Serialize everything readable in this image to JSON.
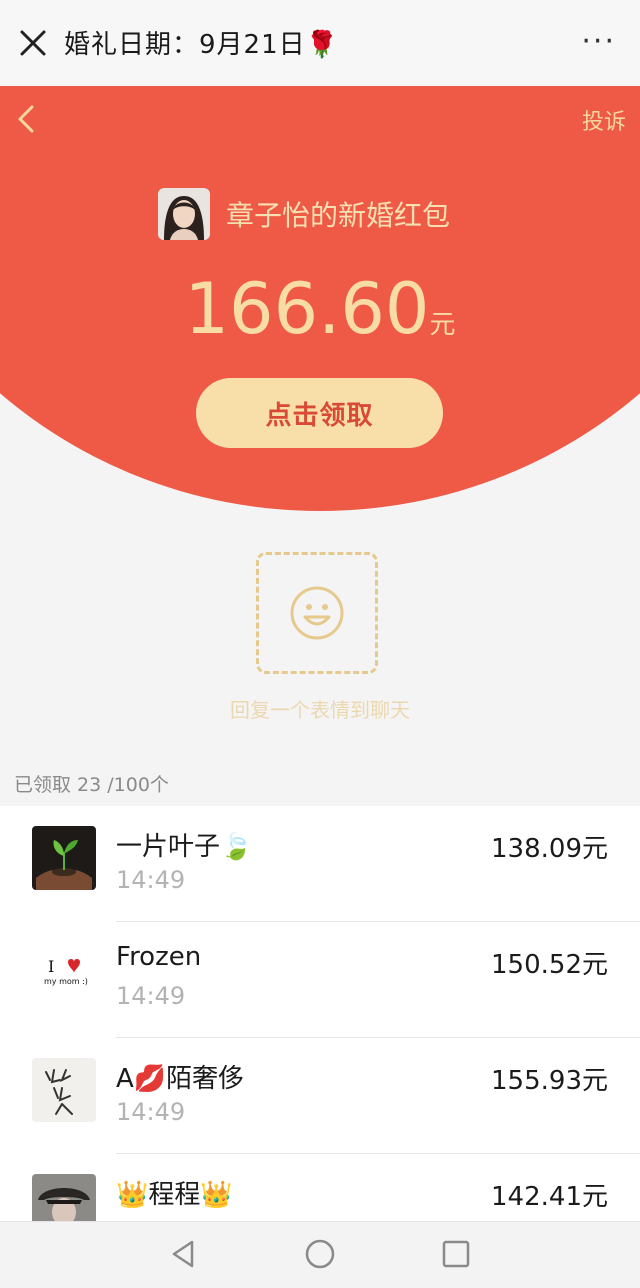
{
  "window": {
    "title": "婚礼日期：9月21日🌹",
    "more": "···"
  },
  "header": {
    "report_label": "投诉",
    "sender_title": "章子怡的新婚红包",
    "amount": "166.60",
    "amount_unit": "元",
    "claim_label": "点击领取"
  },
  "emoji_reply": {
    "hint": "回复一个表情到聊天",
    "icon": "smiley-icon"
  },
  "claimed": {
    "summary": "已领取 23 /100个"
  },
  "list": [
    {
      "name": "一片叶子🍃",
      "time": "14:49",
      "amount": "138.09元",
      "avatar": "sprout-in-hands"
    },
    {
      "name": "Frozen",
      "time": "14:49",
      "amount": "150.52元",
      "avatar": "i-love-my-mom"
    },
    {
      "name": "A💋陌奢侈",
      "time": "14:49",
      "amount": "155.93元",
      "avatar": "calligraphy"
    },
    {
      "name": "👑程程👑",
      "time": "",
      "amount": "142.41元",
      "avatar": "person-with-hat"
    }
  ],
  "colors": {
    "red": "#ef5a47",
    "gold": "#f7dca6",
    "button": "#f8dfa9"
  }
}
